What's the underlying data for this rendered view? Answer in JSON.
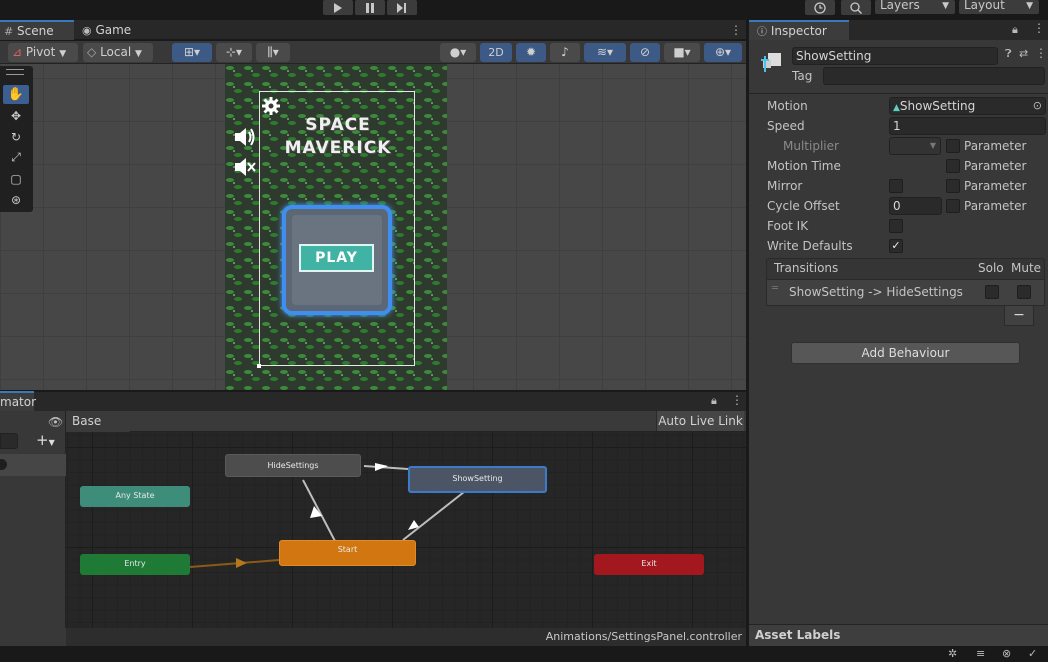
{
  "colors": {
    "accent": "#3a79bb",
    "selected_node": "#465468",
    "orange_node": "#d17610",
    "entry_node": "#1f7a36",
    "exit_node": "#a2181e",
    "anystate_node": "#3e8d7a"
  },
  "topbar": {
    "layers_label": "Layers",
    "layout_label": "Layout"
  },
  "scene_tabs": {
    "scene": "Scene",
    "game": "Game"
  },
  "scene_toolbar": {
    "pivot": "Pivot",
    "local": "Local",
    "mode_2d": "2D"
  },
  "game": {
    "title_line1": "SPACE",
    "title_line2": "MAVERICK",
    "play_label": "PLAY"
  },
  "animator": {
    "tab_label": "mator",
    "breadcrumb": "Base Layer",
    "auto_live_link": "Auto Live Link",
    "footer_path": "Animations/SettingsPanel.controller",
    "nodes": {
      "hide": "HideSettings",
      "show": "ShowSetting",
      "any": "Any State",
      "entry": "Entry",
      "start": "Start",
      "exit": "Exit"
    }
  },
  "inspector": {
    "tab_label": "Inspector",
    "object_name": "ShowSetting",
    "tag_label": "Tag",
    "fields": {
      "motion_label": "Motion",
      "motion_value": "ShowSetting",
      "speed_label": "Speed",
      "speed_value": "1",
      "multiplier_label": "Multiplier",
      "motion_time_label": "Motion Time",
      "mirror_label": "Mirror",
      "cycle_offset_label": "Cycle Offset",
      "cycle_offset_value": "0",
      "foot_ik_label": "Foot IK",
      "write_defaults_label": "Write Defaults",
      "parameter_label": "Parameter"
    },
    "transitions": {
      "header": "Transitions",
      "solo": "Solo",
      "mute": "Mute",
      "items": [
        "ShowSetting -> HideSettings"
      ]
    },
    "add_behaviour": "Add Behaviour",
    "asset_labels": "Asset Labels"
  }
}
